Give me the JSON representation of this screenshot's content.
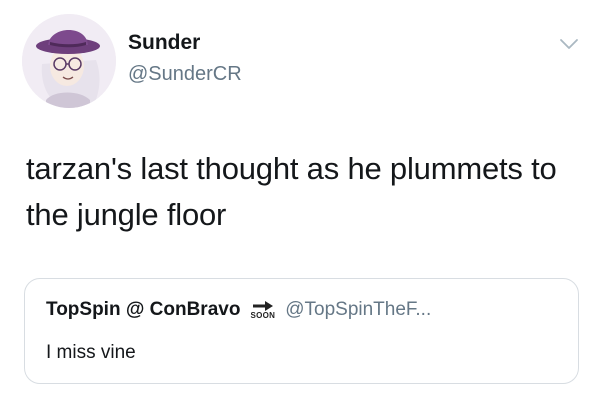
{
  "author": {
    "display_name": "Sunder",
    "handle": "@SunderCR",
    "avatar_icon": "avatar-illustration-icon"
  },
  "menu": {
    "icon": "chevron-down-icon"
  },
  "tweet": {
    "text": "tarzan's last thought as he plummets to the jungle floor"
  },
  "quoted_tweet": {
    "display_name": "TopSpin @ ConBravo",
    "emoji_icon": "soon-arrow-icon",
    "emoji_label": "SOON",
    "handle": "@TopSpinTheF...",
    "text": "I miss vine"
  },
  "colors": {
    "primary_text": "#14171a",
    "secondary_text": "#657786",
    "border": "#d8dde2"
  }
}
